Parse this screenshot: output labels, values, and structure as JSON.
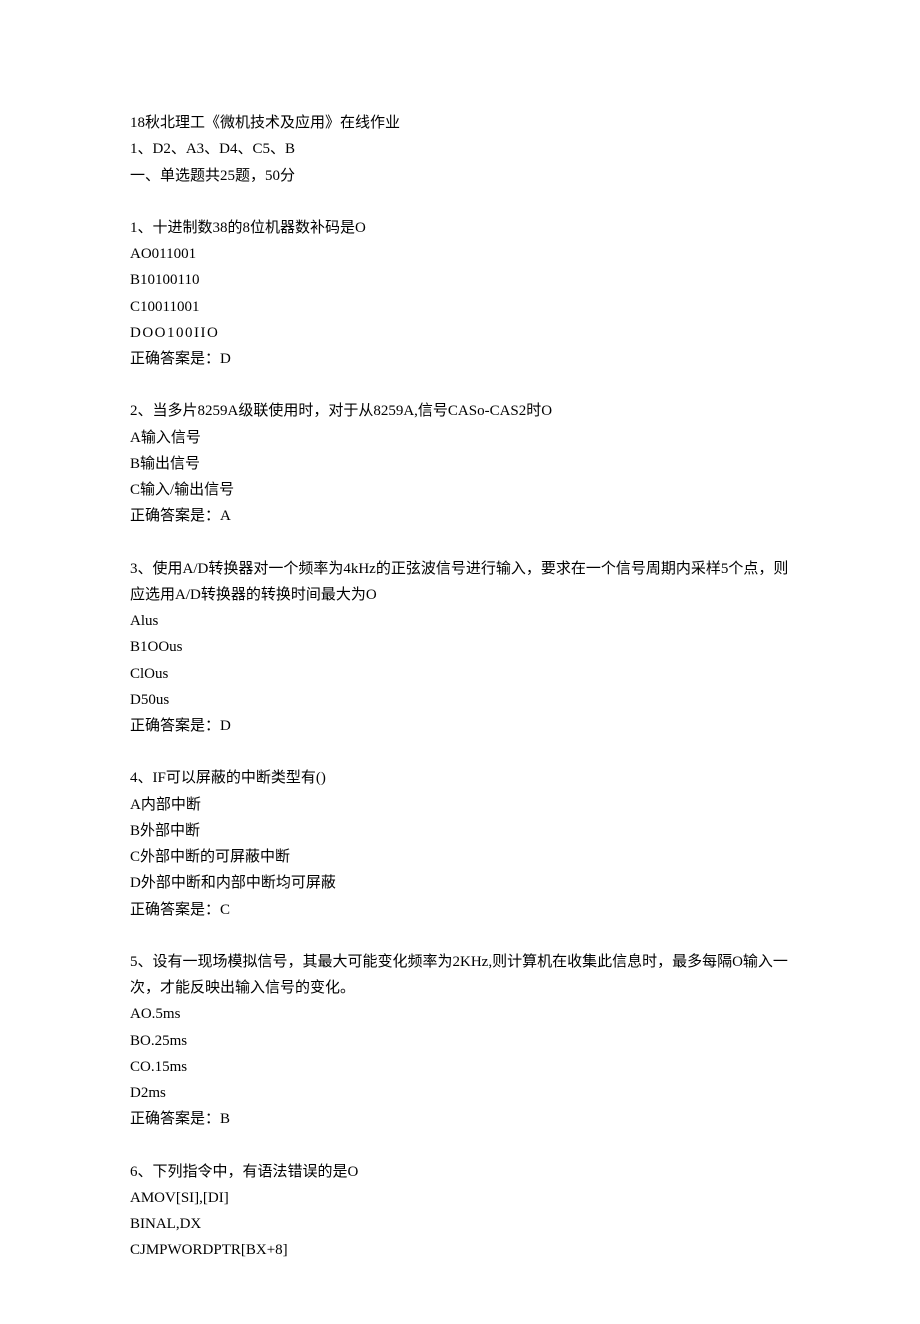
{
  "header": {
    "title": "18秋北理工《微机技术及应用》在线作业",
    "answers_line": "1、D2、A3、D4、C5、B",
    "section_line": "一、单选题共25题，50分"
  },
  "questions": [
    {
      "stem": "1、十进制数38的8位机器数补码是O",
      "options": [
        "AO011001",
        "B10100110",
        "C10011001"
      ],
      "special_option": "DOO100IIO",
      "answer_line": "正确答案是：D"
    },
    {
      "stem": "2、当多片8259A级联使用时，对于从8259A,信号CASo-CAS2时O",
      "options": [
        "A输入信号",
        "B输出信号",
        "C输入/输出信号"
      ],
      "answer_line": "正确答案是：A"
    },
    {
      "stem": "3、使用A/D转换器对一个频率为4kHz的正弦波信号进行输入，要求在一个信号周期内采样5个点，则应选用A/D转换器的转换时间最大为O",
      "options": [
        "Alus",
        "B1OOus",
        "ClOus",
        "D50us"
      ],
      "answer_line": "正确答案是：D"
    },
    {
      "stem": "4、IF可以屏蔽的中断类型有()",
      "options": [
        "A内部中断",
        "B外部中断",
        "C外部中断的可屏蔽中断",
        "D外部中断和内部中断均可屏蔽"
      ],
      "answer_line": "正确答案是：C"
    },
    {
      "stem": "5、设有一现场模拟信号，其最大可能变化频率为2KHz,则计算机在收集此信息时，最多每隔O输入一次，才能反映出输入信号的变化。",
      "options": [
        "AO.5ms",
        "BO.25ms",
        "CO.15ms",
        "D2ms"
      ],
      "answer_line": "正确答案是：B"
    },
    {
      "stem": "6、下列指令中，有语法错误的是O",
      "options": [
        "AMOV[SI],[DI]",
        "BINAL,DX",
        "CJMPWORDPTR[BX+8]"
      ],
      "answer_line": ""
    }
  ]
}
